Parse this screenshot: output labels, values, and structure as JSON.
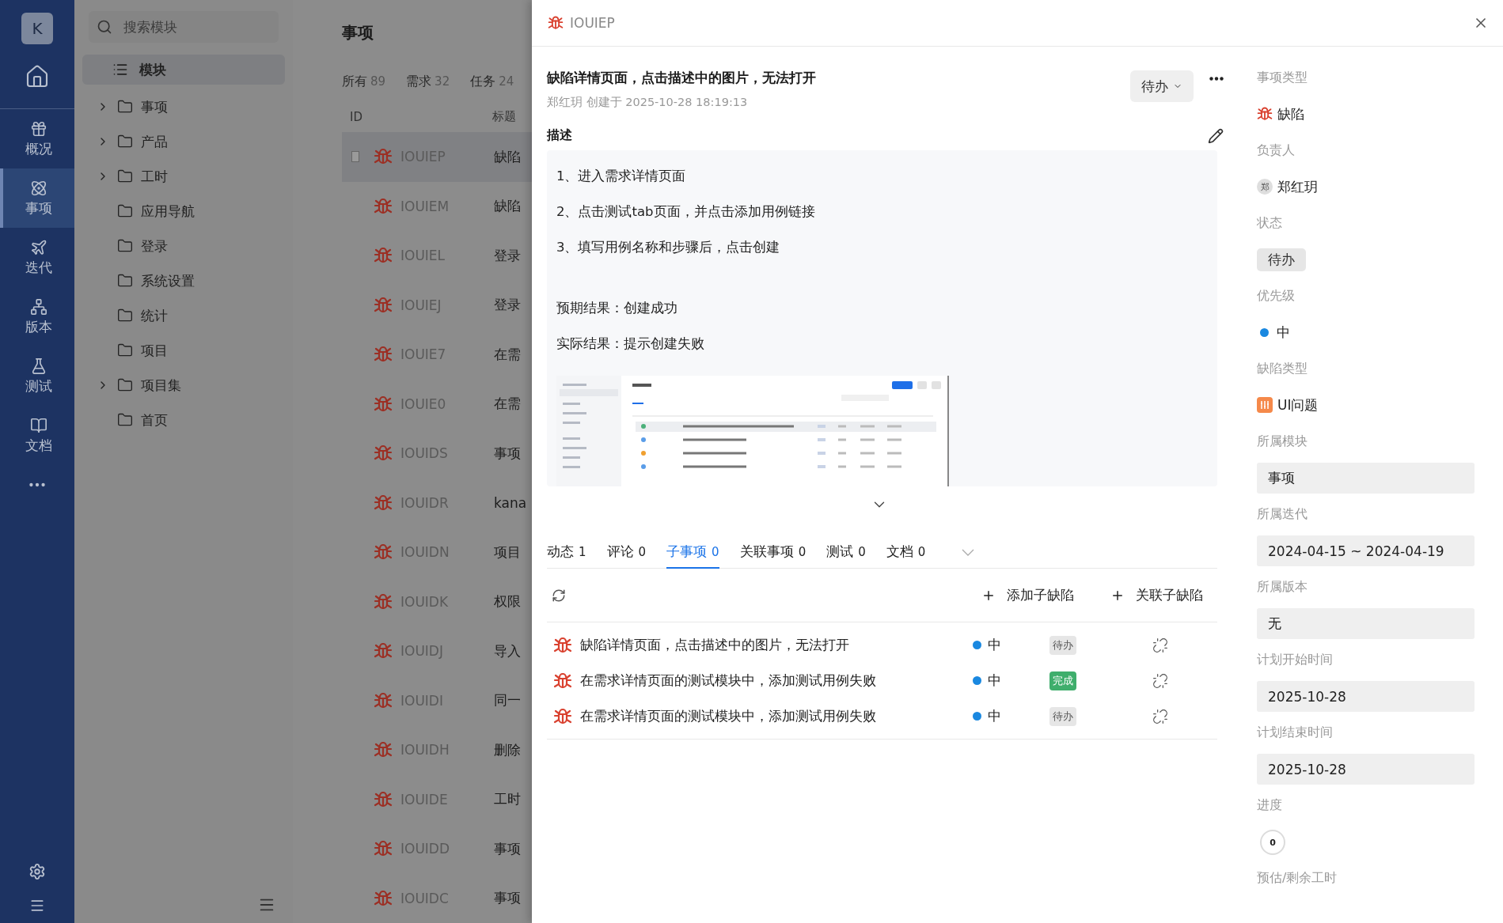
{
  "nav": {
    "avatar": "K",
    "items": [
      {
        "label": "概况",
        "selected": false
      },
      {
        "label": "事项",
        "selected": true
      },
      {
        "label": "迭代",
        "selected": false
      },
      {
        "label": "版本",
        "selected": false
      },
      {
        "label": "测试",
        "selected": false
      },
      {
        "label": "文档",
        "selected": false
      }
    ]
  },
  "module_panel": {
    "search": {
      "placeholder": "搜索模块"
    },
    "header": "模块",
    "tree": [
      {
        "label": "事项",
        "expandable": true
      },
      {
        "label": "产品",
        "expandable": true
      },
      {
        "label": "工时",
        "expandable": true
      },
      {
        "label": "应用导航",
        "expandable": false
      },
      {
        "label": "登录",
        "expandable": false
      },
      {
        "label": "系统设置",
        "expandable": false
      },
      {
        "label": "统计",
        "expandable": false
      },
      {
        "label": "项目",
        "expandable": false
      },
      {
        "label": "项目集",
        "expandable": true
      },
      {
        "label": "首页",
        "expandable": false
      }
    ]
  },
  "list": {
    "title": "事项",
    "tabs": [
      {
        "label": "所有",
        "count": "89",
        "selected": false
      },
      {
        "label": "需求",
        "count": "32",
        "selected": false
      },
      {
        "label": "任务",
        "count": "24",
        "selected": false
      }
    ],
    "columns": [
      "ID",
      "标题"
    ],
    "rows": [
      {
        "id": "IOUIEP",
        "title": "缺陷",
        "selected": true
      },
      {
        "id": "IOUIEM",
        "title": "缺陷",
        "selected": false
      },
      {
        "id": "IOUIEL",
        "title": "登录",
        "selected": false
      },
      {
        "id": "IOUIEJ",
        "title": "登录",
        "selected": false
      },
      {
        "id": "IOUIE7",
        "title": "在需",
        "selected": false
      },
      {
        "id": "IOUIE0",
        "title": "在需",
        "selected": false
      },
      {
        "id": "IOUIDS",
        "title": "事项",
        "selected": false
      },
      {
        "id": "IOUIDR",
        "title": "kana",
        "selected": false
      },
      {
        "id": "IOUIDN",
        "title": "项目",
        "selected": false
      },
      {
        "id": "IOUIDK",
        "title": "权限",
        "selected": false
      },
      {
        "id": "IOUIDJ",
        "title": "导入",
        "selected": false
      },
      {
        "id": "IOUIDI",
        "title": "同一",
        "selected": false
      },
      {
        "id": "IOUIDH",
        "title": "删除",
        "selected": false
      },
      {
        "id": "IOUIDE",
        "title": "工时",
        "selected": false
      },
      {
        "id": "IOUIDD",
        "title": "事项",
        "selected": false
      },
      {
        "id": "IOUIDC",
        "title": "事项",
        "selected": false
      }
    ]
  },
  "drawer": {
    "id": "IOUIEP",
    "title": "缺陷详情页面，点击描述中的图片，无法打开",
    "meta": "郑红玥 创建于 2025-10-28 18:19:13",
    "status": "待办",
    "description_label": "描述",
    "steps": [
      "1、进入需求详情页面",
      "2、点击测试tab页面，并点击添加用例链接",
      "3、填写用例名称和步骤后，点击创建"
    ],
    "results": [
      "预期结果：创建成功",
      "实际结果：提示创建失败"
    ],
    "tabs": [
      {
        "label": "动态",
        "count": "1",
        "selected": false
      },
      {
        "label": "评论",
        "count": "0",
        "selected": false
      },
      {
        "label": "子事项",
        "count": "0",
        "selected": true
      },
      {
        "label": "关联事项",
        "count": "0",
        "selected": false
      },
      {
        "label": "测试",
        "count": "0",
        "selected": false
      },
      {
        "label": "文档",
        "count": "0",
        "selected": false
      }
    ],
    "actions": [
      "添加子缺陷",
      "关联子缺陷"
    ],
    "children": [
      {
        "title": "缺陷详情页面，点击描述中的图片，无法打开",
        "priority": "中",
        "color": "#1a88e0",
        "status": "待办",
        "done": false
      },
      {
        "title": "在需求详情页面的测试模块中，添加测试用例失败",
        "priority": "中",
        "color": "#1a88e0",
        "status": "完成",
        "done": true
      },
      {
        "title": "在需求详情页面的测试模块中，添加测试用例失败",
        "priority": "中",
        "color": "#1a88e0",
        "status": "待办",
        "done": false
      }
    ],
    "fields": [
      {
        "label": "事项类型",
        "kind": "type",
        "value": "缺陷"
      },
      {
        "label": "负责人",
        "kind": "user",
        "value": "郑红玥",
        "avatar": "郑"
      },
      {
        "label": "状态",
        "kind": "tag",
        "value": "待办"
      },
      {
        "label": "优先级",
        "kind": "priority",
        "value": "中",
        "color": "#1a88e0"
      },
      {
        "label": "缺陷类型",
        "kind": "category",
        "value": "UI问题"
      },
      {
        "label": "所属模块",
        "kind": "select",
        "value": "事项"
      },
      {
        "label": "所属迭代",
        "kind": "select",
        "value": "2024-04-15 ~ 2024-04-19"
      },
      {
        "label": "所属版本",
        "kind": "select",
        "value": "无"
      },
      {
        "label": "计划开始时间",
        "kind": "select",
        "value": "2025-10-28"
      },
      {
        "label": "计划结束时间",
        "kind": "select",
        "value": "2025-10-28"
      },
      {
        "label": "进度",
        "kind": "progress",
        "value": "0"
      },
      {
        "label": "预估/剩余工时",
        "kind": "empty"
      }
    ]
  }
}
